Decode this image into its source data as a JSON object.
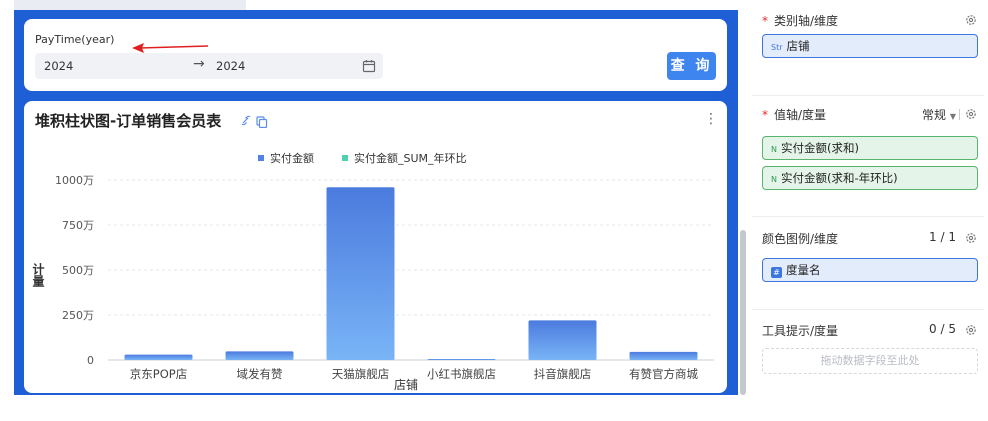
{
  "filter": {
    "label": "PayTime(year)",
    "start": "2024",
    "separator": "→",
    "end": "2024",
    "query_button": "查 询"
  },
  "chart": {
    "title": "堆积柱状图-订单销售会员表",
    "more": "⋮"
  },
  "chart_data": {
    "type": "bar",
    "categories": [
      "京东POP店",
      "域发有赞",
      "天猫旗舰店",
      "小红书旗舰店",
      "抖音旗舰店",
      "有赞官方商城"
    ],
    "series": [
      {
        "name": "实付金额",
        "values": [
          30,
          48,
          960,
          5,
          220,
          45
        ],
        "color": "#5182e4"
      },
      {
        "name": "实付金额_SUM_年环比",
        "values": [
          0,
          0,
          0,
          0,
          0,
          0
        ],
        "color": "#4fd1b0"
      }
    ],
    "y_ticks": [
      "1000万",
      "750万",
      "500万",
      "250万",
      "0"
    ],
    "ylim": [
      0,
      1000
    ],
    "xlabel": "店铺",
    "ylabel": "计量",
    "legend_position": "top-center",
    "grid": true
  },
  "right_panel": {
    "category_axis": {
      "label": "类别轴/维度",
      "required": "*",
      "fields": [
        {
          "tag": "Str",
          "name": "店铺"
        }
      ]
    },
    "value_axis": {
      "label": "值轴/度量",
      "required": "*",
      "mode": "常规",
      "fields": [
        {
          "tag": "N",
          "name": "实付金额(求和)"
        },
        {
          "tag": "N",
          "name": "实付金额(求和-年环比)"
        }
      ]
    },
    "color_legend": {
      "label": "颜色图例/维度",
      "count": "1 / 1",
      "fields": [
        {
          "tag": "#",
          "name": "度量名"
        }
      ]
    },
    "tooltip": {
      "label": "工具提示/度量",
      "count": "0 / 5",
      "dropzone": "拖动数据字段至此处"
    }
  }
}
